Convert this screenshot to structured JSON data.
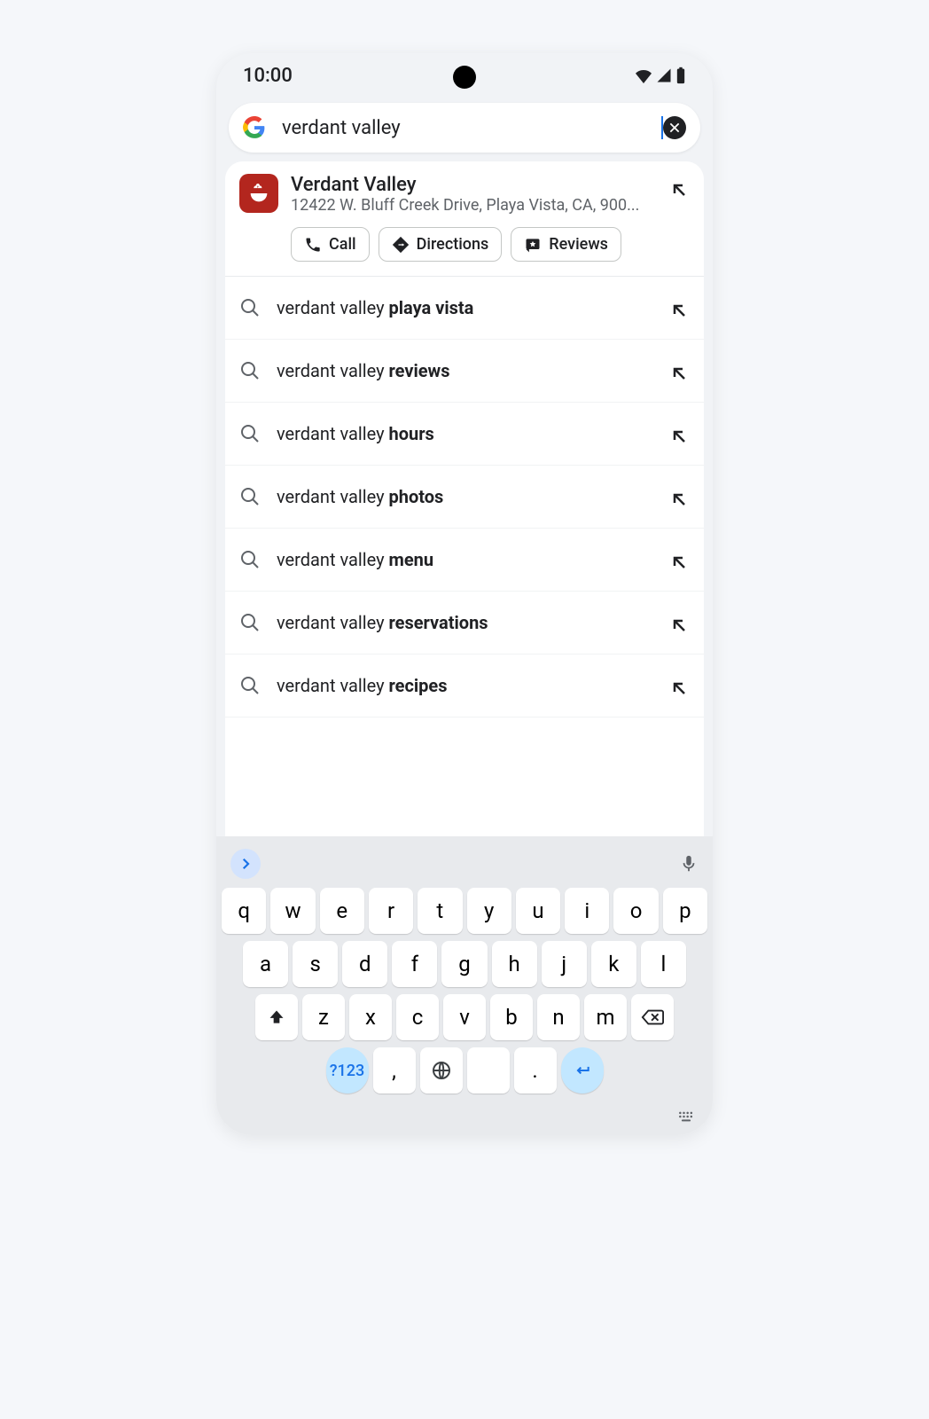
{
  "status": {
    "time": "10:00"
  },
  "search": {
    "query": "verdant valley"
  },
  "top_result": {
    "name": "Verdant Valley",
    "address": "12422 W. Bluff Creek Drive, Playa Vista, CA, 900..."
  },
  "chips": {
    "call": "Call",
    "directions": "Directions",
    "reviews": "Reviews"
  },
  "suggestions": [
    {
      "prefix": "verdant valley ",
      "bold": "playa vista"
    },
    {
      "prefix": "verdant valley ",
      "bold": "reviews"
    },
    {
      "prefix": "verdant valley ",
      "bold": "hours"
    },
    {
      "prefix": "verdant valley ",
      "bold": "photos"
    },
    {
      "prefix": "verdant valley ",
      "bold": "menu"
    },
    {
      "prefix": "verdant valley ",
      "bold": "reservations"
    },
    {
      "prefix": "verdant valley ",
      "bold": "recipes"
    }
  ],
  "keyboard": {
    "row1": [
      "q",
      "w",
      "e",
      "r",
      "t",
      "y",
      "u",
      "i",
      "o",
      "p"
    ],
    "row2": [
      "a",
      "s",
      "d",
      "f",
      "g",
      "h",
      "j",
      "k",
      "l"
    ],
    "row3": [
      "z",
      "x",
      "c",
      "v",
      "b",
      "n",
      "m"
    ],
    "num_label": "?123",
    "comma": ",",
    "period": "."
  }
}
